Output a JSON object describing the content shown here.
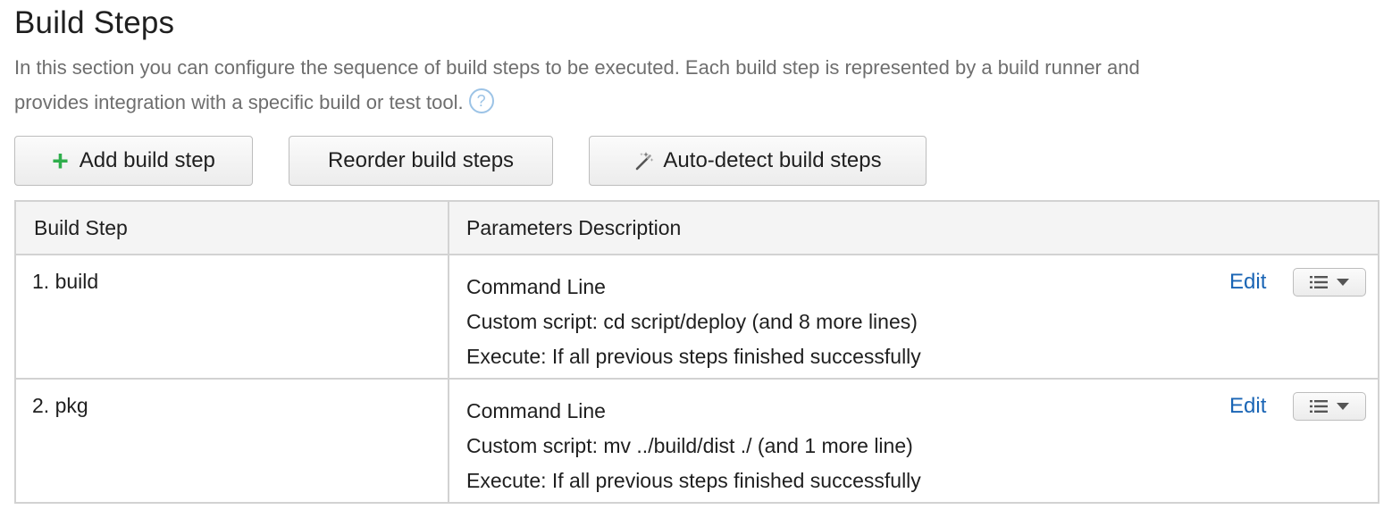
{
  "header": {
    "title": "Build Steps",
    "description": "In this section you can configure the sequence of build steps to be executed. Each build step is represented by a build runner and provides integration with a specific build or test tool.",
    "help_icon": "question-circle-icon"
  },
  "toolbar": {
    "add_label": "Add build step",
    "reorder_label": "Reorder build steps",
    "autodetect_label": "Auto-detect build steps",
    "add_icon": "plus-icon",
    "autodetect_icon": "magic-wand-icon"
  },
  "table": {
    "columns": [
      "Build Step",
      "Parameters Description"
    ],
    "rows": [
      {
        "name": "1. build",
        "runner": "Command Line",
        "script": "Custom script: cd script/deploy (and 8 more lines)",
        "execute": "Execute: If all previous steps finished successfully",
        "edit_label": "Edit"
      },
      {
        "name": "2. pkg",
        "runner": "Command Line",
        "script": "Custom script: mv ../build/dist ./ (and 1 more line)",
        "execute": "Execute: If all previous steps finished successfully",
        "edit_label": "Edit"
      }
    ]
  },
  "colors": {
    "link": "#1a65b5",
    "plus": "#2fae4c",
    "help": "#9cc3e6",
    "border": "#d2d2d2",
    "header_bg": "#f4f4f4"
  }
}
